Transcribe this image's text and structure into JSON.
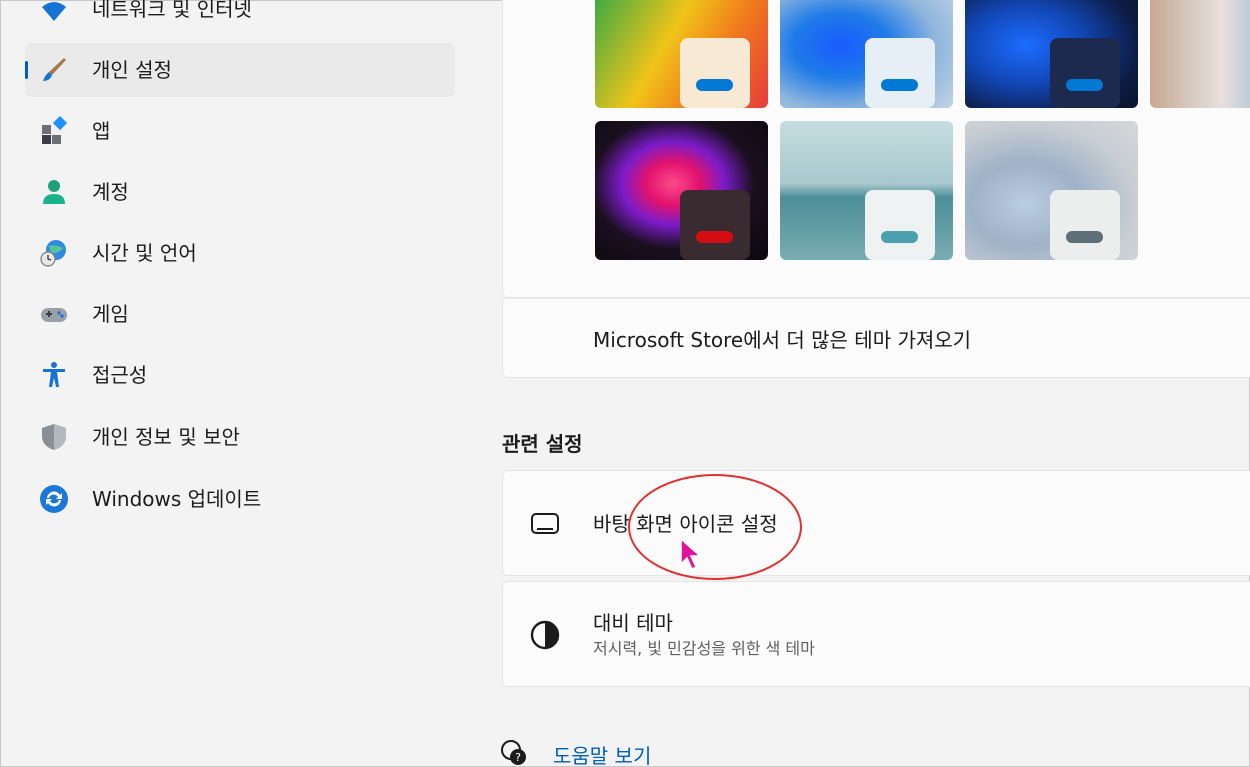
{
  "sidebar": {
    "items": [
      {
        "label": "네트워크 및 인터넷",
        "icon": "wifi-icon"
      },
      {
        "label": "개인 설정",
        "icon": "paintbrush-icon",
        "active": true
      },
      {
        "label": "앱",
        "icon": "apps-icon"
      },
      {
        "label": "계정",
        "icon": "person-icon"
      },
      {
        "label": "시간 및 언어",
        "icon": "globe-clock-icon"
      },
      {
        "label": "게임",
        "icon": "gamepad-icon"
      },
      {
        "label": "접근성",
        "icon": "accessibility-icon"
      },
      {
        "label": "개인 정보 및 보안",
        "icon": "shield-icon"
      },
      {
        "label": "Windows 업데이트",
        "icon": "sync-icon"
      }
    ]
  },
  "themes": {
    "tiles": [
      {
        "name": "theme-colorful",
        "accent": "#0078d4"
      },
      {
        "name": "theme-bloom-light",
        "accent": "#0078d4"
      },
      {
        "name": "theme-bloom-dark",
        "accent": "#0078d4"
      },
      {
        "name": "theme-flower-photo",
        "accent": "#0078d4"
      },
      {
        "name": "theme-glow",
        "accent": "#d40d12"
      },
      {
        "name": "theme-captured-motion",
        "accent": "#4aa0ad"
      },
      {
        "name": "theme-flow",
        "accent": "#5f6f7a"
      }
    ],
    "store_link": "Microsoft Store에서 더 많은 테마 가져오기"
  },
  "related": {
    "section_title": "관련 설정",
    "desktop_icons": {
      "title": "바탕 화면 아이콘 설정",
      "icon": "monitor-icon"
    },
    "contrast_themes": {
      "title": "대비 테마",
      "subtitle": "저시력, 빛 민감성을 위한 색 테마",
      "icon": "contrast-icon"
    }
  },
  "help": {
    "label": "도움말 보기",
    "icon": "help-chat-icon"
  },
  "colors": {
    "accent": "#005fb8",
    "annotation": "#e0312f",
    "cursor": "#e0139f"
  }
}
